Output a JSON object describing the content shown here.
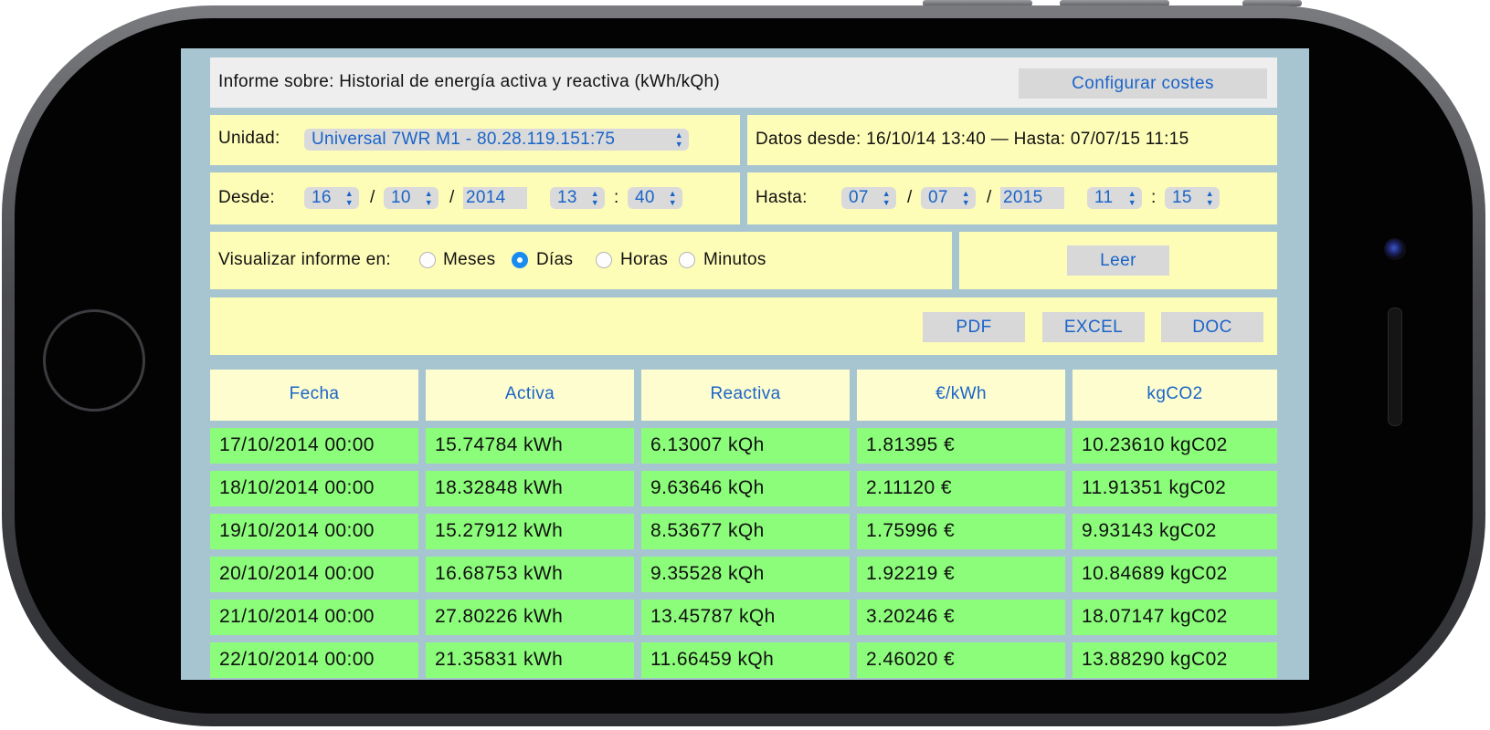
{
  "report": {
    "title": "Informe sobre: Historial de energía activa y reactiva (kWh/kQh)",
    "configure_button": "Configurar costes"
  },
  "unit": {
    "label": "Unidad:",
    "selected": "Universal 7WR M1 - 80.28.119.151:75"
  },
  "range_info": "Datos desde: 16/10/14 13:40 — Hasta: 07/07/15 11:15",
  "from": {
    "label": "Desde:",
    "day": "16",
    "month": "10",
    "year": "2014",
    "hour": "13",
    "minute": "40"
  },
  "to": {
    "label": "Hasta:",
    "day": "07",
    "month": "07",
    "year": "2015",
    "hour": "11",
    "minute": "15"
  },
  "separators": {
    "date": "/",
    "time": ":"
  },
  "view": {
    "label": "Visualizar informe en:",
    "options": [
      "Meses",
      "Días",
      "Horas",
      "Minutos"
    ],
    "selected": "Días"
  },
  "read_button": "Leer",
  "export": {
    "pdf": "PDF",
    "excel": "EXCEL",
    "doc": "DOC"
  },
  "table": {
    "headers": [
      "Fecha",
      "Activa",
      "Reactiva",
      "€/kWh",
      "kgCO2"
    ],
    "rows": [
      [
        "17/10/2014 00:00",
        "15.74784 kWh",
        "6.13007 kQh",
        "1.81395 €",
        "10.23610 kgC02"
      ],
      [
        "18/10/2014 00:00",
        "18.32848 kWh",
        "9.63646 kQh",
        "2.11120 €",
        "11.91351 kgC02"
      ],
      [
        "19/10/2014 00:00",
        "15.27912 kWh",
        "8.53677 kQh",
        "1.75996 €",
        "9.93143 kgC02"
      ],
      [
        "20/10/2014 00:00",
        "16.68753 kWh",
        "9.35528 kQh",
        "1.92219 €",
        "10.84689 kgC02"
      ],
      [
        "21/10/2014 00:00",
        "27.80226 kWh",
        "13.45787 kQh",
        "3.20246 €",
        "18.07147 kgC02"
      ],
      [
        "22/10/2014 00:00",
        "21.35831 kWh",
        "11.66459 kQh",
        "2.46020 €",
        "13.88290 kgC02"
      ]
    ]
  },
  "colors": {
    "screen_bg": "#a7c5d0",
    "panel_bg": "#fdfdb8",
    "header_bg": "#fdfdcf",
    "row_bg": "#8cfd7a",
    "accent": "#1a64c8"
  },
  "icons": {
    "select_arrows": "updown-arrows-icon",
    "home": "home-button-icon",
    "camera": "front-camera-icon"
  }
}
